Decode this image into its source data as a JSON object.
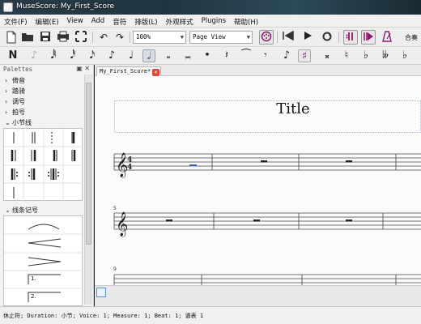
{
  "window": {
    "title": "MuseScore: My_First_Score"
  },
  "menu": [
    "文件(F)",
    "编辑(E)",
    "View",
    "Add",
    "音符",
    "排版(L)",
    "外观样式",
    "Plugins",
    "帮助(H)"
  ],
  "toolbar": {
    "zoom_value": "100%",
    "view_mode": "Page View",
    "right_label": "合奏"
  },
  "palette": {
    "title": "Palettes",
    "sections": [
      "倚音",
      "踏骑",
      "调号",
      "拍号",
      "小节线"
    ],
    "open_section": "小节线",
    "lines_section": "线条记号",
    "volta_labels": [
      "1.",
      "2."
    ]
  },
  "score": {
    "tab_label": "My_First_Score*",
    "title": "Title",
    "measure_numbers": [
      "5",
      "9"
    ]
  },
  "status": {
    "text": "休止符; Duration: 小节; Voice: 1;  Measure: 1; Beat: 1; 谱表 1"
  }
}
